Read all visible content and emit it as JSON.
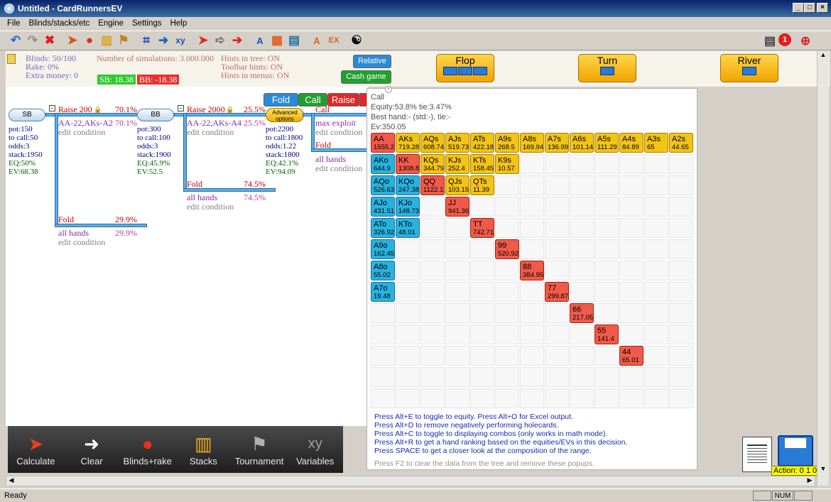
{
  "window": {
    "title": "Untitled - CardRunnersEV"
  },
  "menu": [
    "File",
    "Blinds/stacks/etc",
    "Engine",
    "Settings",
    "Help"
  ],
  "info": {
    "blinds": "Blinds: 50/100",
    "rake": "Rake: 0%",
    "extra": "Extra money: 0",
    "sims": "Number of simulations: 3.000.000",
    "hints_tree": "Hints in tree: ON",
    "hints_toolbar": "Toolbar hints: ON",
    "hints_menus": "Hints in menus: ON",
    "sb_badge": "SB: 18.38",
    "bb_badge": "BB: -18.38",
    "relative": "Relative",
    "cash": "Cash game"
  },
  "streets": [
    "Flop",
    "Turn",
    "River"
  ],
  "colors": {
    "blue": "#27b3de",
    "yellow": "#f4c415",
    "red": "#f05a4a",
    "sb_green": "#2ecc2e",
    "bb_red": "#e83030"
  },
  "tree": {
    "sb": {
      "label": "SB",
      "pot": "pot:150",
      "tocall": "to call:50",
      "odds": "odds:3",
      "stack": "stack:1950",
      "eq": "EQ:50%",
      "ev": "EV:68.38"
    },
    "raise200": {
      "label": "Raise 200",
      "pct": "70.1%",
      "range": "AA-22,AKs-A2",
      "rpct": "70.1%",
      "cond": "edit condition"
    },
    "fold1": {
      "label": "Fold",
      "pct": "29.9%",
      "hands": "all hands",
      "hpct": "29.9%",
      "cond": "edit condition"
    },
    "bb": {
      "label": "BB",
      "pot": "pot:300",
      "tocall": "to call:100",
      "odds": "odds:3",
      "stack": "stack:1900",
      "eq": "EQ:45.9%",
      "ev": "EV:52.5"
    },
    "raise2000": {
      "label": "Raise 2000",
      "pct": "25.5%",
      "range": "AA-22,AKs-A4",
      "rpct": "25.5%",
      "cond": "edit condition"
    },
    "fold2": {
      "label": "Fold",
      "pct": "74.5%",
      "hands": "all hands",
      "hpct": "74.5%",
      "cond": "edit condition"
    },
    "node3": {
      "adv": "Advanced options",
      "pot": "pot:2200",
      "tocall": "to call:1800",
      "odds": "odds:1.22",
      "stack": "stack:1800",
      "eq": "EQ:42.1%",
      "ev": "EV:94.09"
    },
    "call": {
      "label": "Call",
      "exploit": "max exploit",
      "cond": "edit condition"
    },
    "fold3": {
      "label": "Fold",
      "hands": "all hands",
      "cond": "edit condition"
    }
  },
  "actionbar": [
    "Fold",
    "Call",
    "Raise"
  ],
  "popup": {
    "title": "Call",
    "equity": "Equity:53.8% tie:3.47%",
    "best": "Best hand:- (std:-), tie:-",
    "ev": "Ev:350.05",
    "hands": [
      {
        "n": "AA",
        "v": "1555.2",
        "c": "red",
        "r": 0,
        "k": 0
      },
      {
        "n": "AKs",
        "v": "719.28",
        "c": "yellow",
        "r": 0,
        "k": 1
      },
      {
        "n": "AQs",
        "v": "608.74",
        "c": "yellow",
        "r": 0,
        "k": 2
      },
      {
        "n": "AJs",
        "v": "519.73",
        "c": "yellow",
        "r": 0,
        "k": 3
      },
      {
        "n": "ATs",
        "v": "422.18",
        "c": "yellow",
        "r": 0,
        "k": 4
      },
      {
        "n": "A9s",
        "v": "268.5",
        "c": "yellow",
        "r": 0,
        "k": 5
      },
      {
        "n": "A8s",
        "v": "169.94",
        "c": "yellow",
        "r": 0,
        "k": 6
      },
      {
        "n": "A7s",
        "v": "136.99",
        "c": "yellow",
        "r": 0,
        "k": 7
      },
      {
        "n": "A6s",
        "v": "101.14",
        "c": "yellow",
        "r": 0,
        "k": 8
      },
      {
        "n": "A5s",
        "v": "111.29",
        "c": "yellow",
        "r": 0,
        "k": 9
      },
      {
        "n": "A4s",
        "v": "84.89",
        "c": "yellow",
        "r": 0,
        "k": 10
      },
      {
        "n": "A3s",
        "v": "65",
        "c": "yellow",
        "r": 0,
        "k": 11
      },
      {
        "n": "A2s",
        "v": "44.65",
        "c": "yellow",
        "r": 0,
        "k": 12
      },
      {
        "n": "AKo",
        "v": "644.9",
        "c": "blue",
        "r": 1,
        "k": 0
      },
      {
        "n": "KK",
        "v": "1308.8",
        "c": "red",
        "r": 1,
        "k": 1
      },
      {
        "n": "KQs",
        "v": "344.79",
        "c": "yellow",
        "r": 1,
        "k": 2
      },
      {
        "n": "KJs",
        "v": "252.4",
        "c": "yellow",
        "r": 1,
        "k": 3
      },
      {
        "n": "KTs",
        "v": "158.45",
        "c": "yellow",
        "r": 1,
        "k": 4
      },
      {
        "n": "K9s",
        "v": "10.57",
        "c": "yellow",
        "r": 1,
        "k": 5
      },
      {
        "n": "AQo",
        "v": "526.63",
        "c": "blue",
        "r": 2,
        "k": 0
      },
      {
        "n": "KQo",
        "v": "247.38",
        "c": "blue",
        "r": 2,
        "k": 1
      },
      {
        "n": "QQ",
        "v": "1122.1",
        "c": "red",
        "r": 2,
        "k": 2
      },
      {
        "n": "QJs",
        "v": "103.15",
        "c": "yellow",
        "r": 2,
        "k": 3
      },
      {
        "n": "QTs",
        "v": "11.39",
        "c": "yellow",
        "r": 2,
        "k": 4
      },
      {
        "n": "AJo",
        "v": "431.51",
        "c": "blue",
        "r": 3,
        "k": 0
      },
      {
        "n": "KJo",
        "v": "148.73",
        "c": "blue",
        "r": 3,
        "k": 1
      },
      {
        "n": "JJ",
        "v": "941.36",
        "c": "red",
        "r": 3,
        "k": 3
      },
      {
        "n": "ATo",
        "v": "326.92",
        "c": "blue",
        "r": 4,
        "k": 0
      },
      {
        "n": "KTo",
        "v": "48.01",
        "c": "blue",
        "r": 4,
        "k": 1
      },
      {
        "n": "TT",
        "v": "742.71",
        "c": "red",
        "r": 4,
        "k": 4
      },
      {
        "n": "A9o",
        "v": "162.45",
        "c": "blue",
        "r": 5,
        "k": 0
      },
      {
        "n": "99",
        "v": "520.92",
        "c": "red",
        "r": 5,
        "k": 5
      },
      {
        "n": "A8o",
        "v": "55.02",
        "c": "blue",
        "r": 6,
        "k": 0
      },
      {
        "n": "88",
        "v": "384.95",
        "c": "red",
        "r": 6,
        "k": 6
      },
      {
        "n": "A7o",
        "v": "19.48",
        "c": "blue",
        "r": 7,
        "k": 0
      },
      {
        "n": "77",
        "v": "299.87",
        "c": "red",
        "r": 7,
        "k": 7
      },
      {
        "n": "66",
        "v": "217.05",
        "c": "red",
        "r": 8,
        "k": 8
      },
      {
        "n": "55",
        "v": "141.4",
        "c": "red",
        "r": 9,
        "k": 9
      },
      {
        "n": "44",
        "v": "65.01",
        "c": "red",
        "r": 10,
        "k": 10
      }
    ],
    "help": [
      "Press Alt+E to toggle to equity. Press Alt+O for Excel output.",
      "Press Alt+D to remove negatively performing holecards.",
      "Press Alt+C to toggle to displaying combos (only works in math mode).",
      "Press Alt+R to get a hand ranking based on the equities/EVs in this decision.",
      "Press SPACE to get a closer look at the composition of the range."
    ],
    "f2": "Press F2 to clear the data from the tree and remove these popups."
  },
  "bottom": [
    "Calculate",
    "Clear",
    "Blinds+rake",
    "Stacks",
    "Tournament",
    "Variables"
  ],
  "action_label": "Action: 0 1 0",
  "status": {
    "ready": "Ready",
    "num": "NUM"
  }
}
